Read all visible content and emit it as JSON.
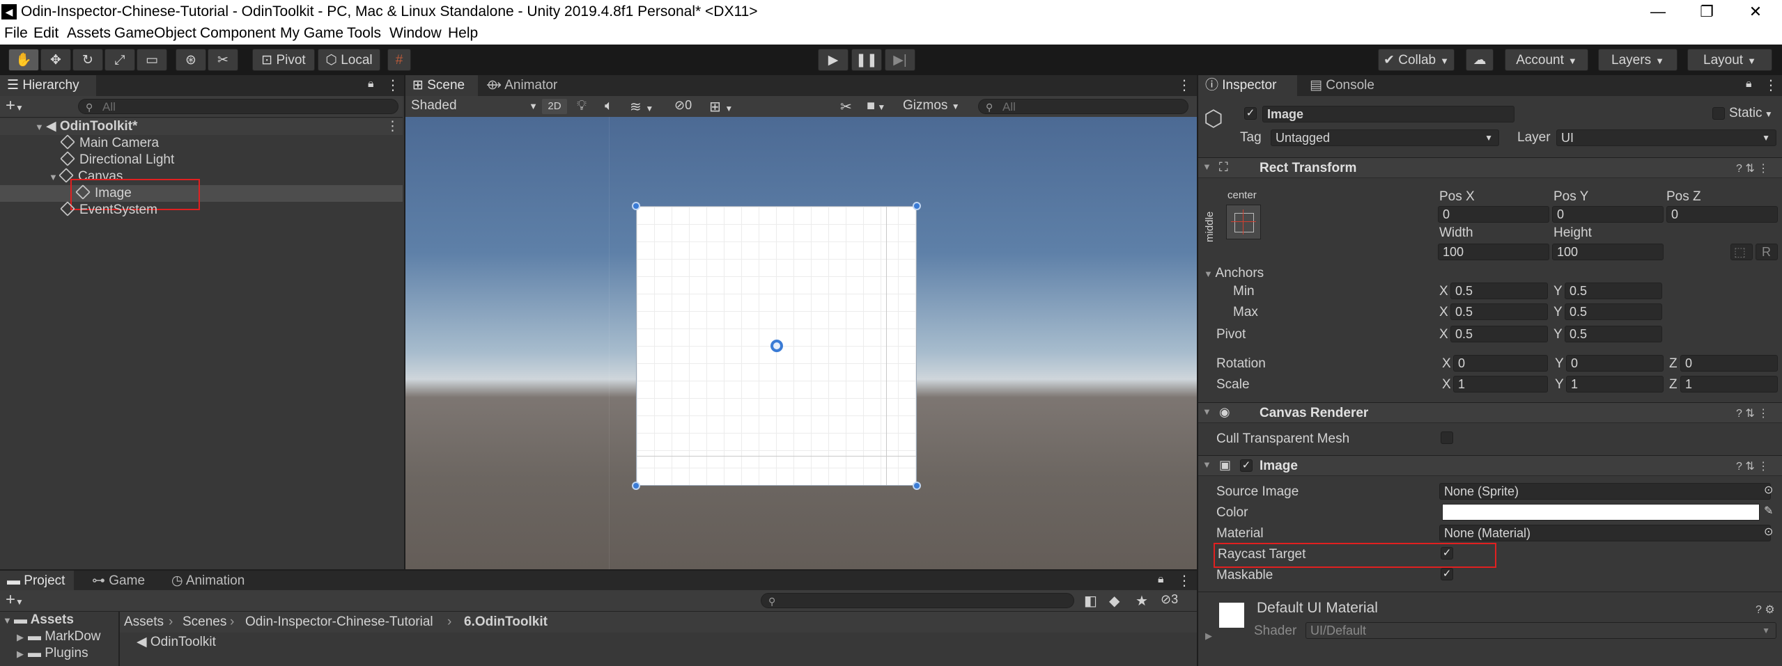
{
  "window": {
    "title": "Odin-Inspector-Chinese-Tutorial - OdinToolkit - PC, Mac & Linux Standalone - Unity 2019.4.8f1 Personal* <DX11>",
    "min": "—",
    "max": "❐",
    "close": "✕"
  },
  "menu": [
    "File",
    "Edit",
    "Assets",
    "GameObject",
    "Component",
    "My Game",
    "Tools",
    "Window",
    "Help"
  ],
  "toolbar": {
    "pivot": "Pivot",
    "local": "Local",
    "collab": "Collab",
    "account": "Account",
    "layers": "Layers",
    "layout": "Layout"
  },
  "hierarchy": {
    "tab": "Hierarchy",
    "search_placeholder": "All",
    "scene": "OdinToolkit*",
    "items": [
      "Main Camera",
      "Directional Light",
      "Canvas",
      "Image",
      "EventSystem"
    ],
    "selected": "Image"
  },
  "scene": {
    "tabs": [
      "Scene",
      "Animator"
    ],
    "shading": "Shaded",
    "mode2d": "2D",
    "hidden_count": "0",
    "gizmos": "Gizmos",
    "search_placeholder": "All"
  },
  "project": {
    "tabs": [
      "Project",
      "Game",
      "Animation"
    ],
    "tree": [
      "Assets",
      "MarkDow",
      "Plugins"
    ],
    "breadcrumb": [
      "Assets",
      "Scenes",
      "Odin-Inspector-Chinese-Tutorial",
      "6.OdinToolkit"
    ],
    "items": [
      "OdinToolkit"
    ],
    "hidden_count": "3"
  },
  "inspector": {
    "tabs": [
      "Inspector",
      "Console"
    ],
    "object_name": "Image",
    "static_label": "Static",
    "tag_label": "Tag",
    "tag": "Untagged",
    "layer_label": "Layer",
    "layer": "UI",
    "rect_transform": {
      "title": "Rect Transform",
      "anchor_h": "center",
      "anchor_v": "middle",
      "pos_x_label": "Pos X",
      "pos_y_label": "Pos Y",
      "pos_z_label": "Pos Z",
      "pos_x": "0",
      "pos_y": "0",
      "pos_z": "0",
      "width_label": "Width",
      "height_label": "Height",
      "width": "100",
      "height": "100",
      "r_button": "R",
      "anchors_label": "Anchors",
      "min_label": "Min",
      "max_label": "Max",
      "min_x": "0.5",
      "min_y": "0.5",
      "max_x": "0.5",
      "max_y": "0.5",
      "pivot_label": "Pivot",
      "pivot_x": "0.5",
      "pivot_y": "0.5",
      "rotation_label": "Rotation",
      "rot_x": "0",
      "rot_y": "0",
      "rot_z": "0",
      "scale_label": "Scale",
      "scale_x": "1",
      "scale_y": "1",
      "scale_z": "1",
      "x": "X",
      "y": "Y",
      "z": "Z"
    },
    "canvas_renderer": {
      "title": "Canvas Renderer",
      "cull_label": "Cull Transparent Mesh",
      "cull": false
    },
    "image": {
      "title": "Image",
      "source_label": "Source Image",
      "source": "None (Sprite)",
      "color_label": "Color",
      "color": "#ffffff",
      "material_label": "Material",
      "material": "None (Material)",
      "raycast_label": "Raycast Target",
      "raycast": true,
      "maskable_label": "Maskable",
      "maskable": true
    },
    "material": {
      "name": "Default UI Material",
      "shader_label": "Shader",
      "shader": "UI/Default"
    }
  },
  "colors": {
    "accent": "#3a7bd5",
    "highlight": "#e02020",
    "panel": "#383838"
  }
}
